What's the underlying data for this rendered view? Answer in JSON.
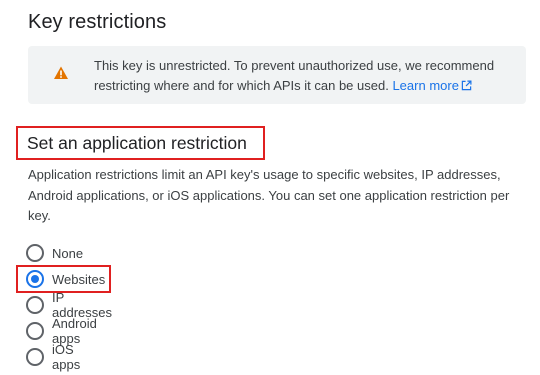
{
  "header": {
    "title": "Key restrictions"
  },
  "warning": {
    "icon": "warning-triangle-icon",
    "text": "This key is unrestricted. To prevent unauthorized use, we recommend restricting where and for which APIs it can be used.",
    "link_label": "Learn more",
    "link_icon": "open-in-new-icon",
    "icon_color": "#e37400",
    "link_color": "#1a73e8"
  },
  "app_restriction": {
    "title": "Set an application restriction",
    "description": "Application restrictions limit an API key's usage to specific websites, IP addresses, Android applications, or iOS applications. You can set one application restriction per key.",
    "options": [
      {
        "label": "None",
        "checked": false
      },
      {
        "label": "Websites",
        "checked": true
      },
      {
        "label": "IP addresses",
        "checked": false
      },
      {
        "label": "Android apps",
        "checked": false
      },
      {
        "label": "iOS apps",
        "checked": false
      }
    ],
    "highlight_color": "#e02020",
    "accent_color": "#1a73e8"
  }
}
